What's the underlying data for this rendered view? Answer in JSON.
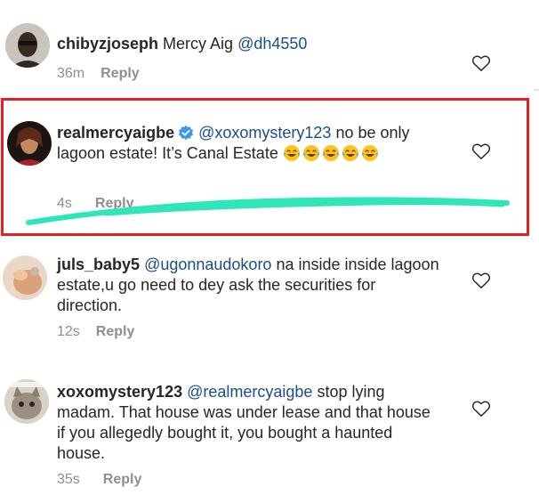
{
  "comments": [
    {
      "username": "chibyzjoseph",
      "text_before": "Mercy Aig",
      "mention": "@dh4550",
      "text_after": "",
      "time": "36m",
      "reply_label": "Reply"
    },
    {
      "username": "realmercyaigbe",
      "verified": true,
      "mention": "@xoxomystery123",
      "text_after": " no be only lagoon estate! It’s Canal Estate",
      "emoji_count": 5,
      "time": "4s",
      "reply_label": "Reply"
    },
    {
      "username": "juls_baby5",
      "mention": "@ugonnaudokoro",
      "text_after": " na inside inside lagoon estate,u go need to dey ask the securities for direction.",
      "time": "12s",
      "reply_label": "Reply"
    },
    {
      "username": "xoxomystery123",
      "mention": "@realmercyaigbe",
      "text_after": " stop lying madam. That house was under lease and that house if you allegedly bought it, you bought a haunted house.",
      "time": "35s",
      "reply_label": "Reply"
    }
  ],
  "colors": {
    "highlight_border": "#e2202a",
    "scribble": "#2ee6b8",
    "mention": "#1a4e8a",
    "verified": "#3897f0"
  },
  "icons": [
    "heart-outline-icon",
    "verified-badge-icon",
    "face-with-tears-of-joy-emoji"
  ]
}
